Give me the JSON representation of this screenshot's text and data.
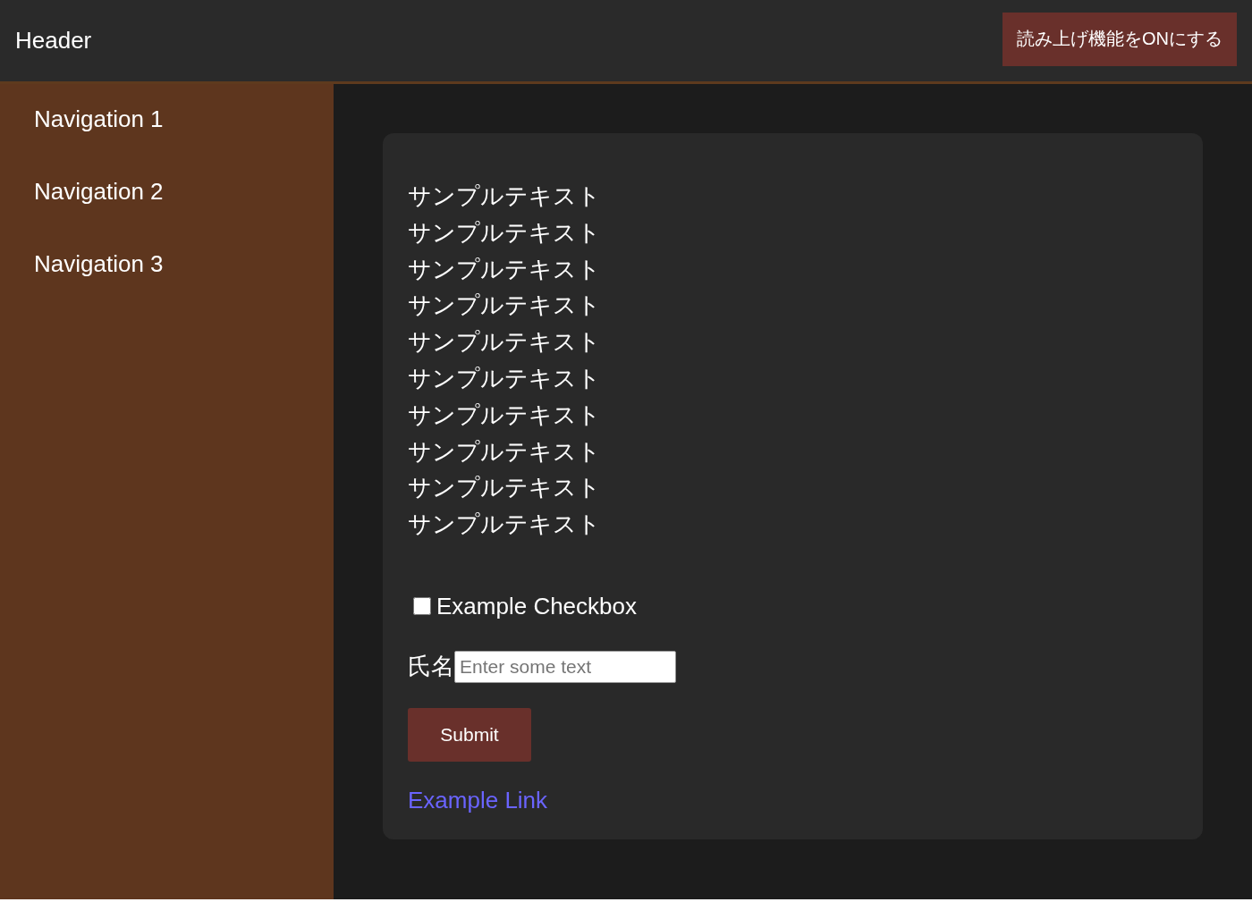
{
  "header": {
    "title": "Header",
    "read_aloud_button": "読み上げ機能をONにする"
  },
  "sidebar": {
    "items": [
      {
        "label": "Navigation 1"
      },
      {
        "label": "Navigation 2"
      },
      {
        "label": "Navigation 3"
      }
    ]
  },
  "content": {
    "paragraphs": [
      "サンプルテキスト",
      "サンプルテキスト",
      "サンプルテキスト",
      "サンプルテキスト",
      "サンプルテキスト",
      "サンプルテキスト",
      "サンプルテキスト",
      "サンプルテキスト",
      "サンプルテキスト",
      "サンプルテキスト"
    ],
    "checkbox": {
      "label": "Example Checkbox",
      "checked": false
    },
    "name_field": {
      "label": "氏名",
      "placeholder": "Enter some text"
    },
    "submit_button": "Submit",
    "link": "Example Link"
  }
}
